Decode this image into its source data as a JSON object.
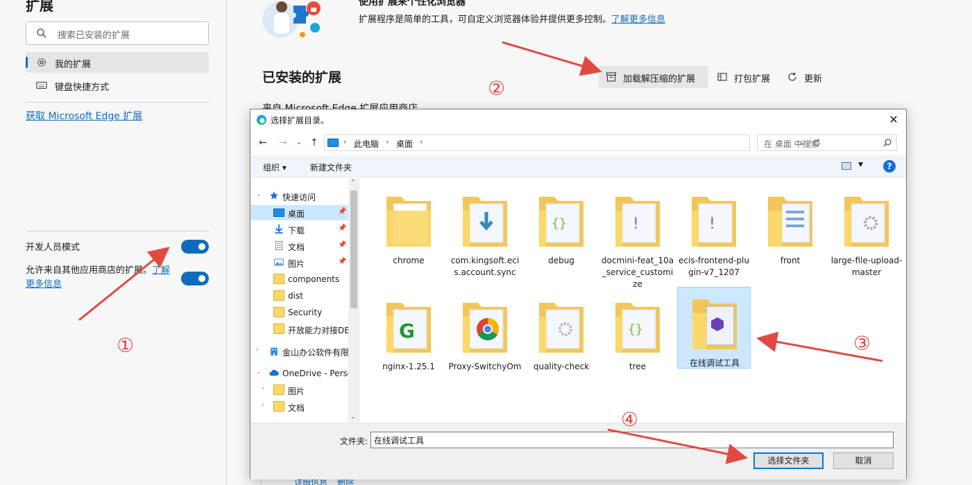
{
  "sidebar": {
    "title": "扩展",
    "search_placeholder": "搜索已安装的扩展",
    "items": [
      {
        "label": "我的扩展",
        "icon": "gear-icon"
      },
      {
        "label": "键盘快捷方式",
        "icon": "keyboard-icon"
      }
    ],
    "get_link": "获取 Microsoft Edge 扩展",
    "dev_mode_label": "开发人员模式",
    "allow_text": "允许来自其他应用商店的扩展。",
    "allow_link": "了解更多信息"
  },
  "hero": {
    "title": "使用扩展来个性化浏览器",
    "desc": "扩展程序是简单的工具，可自定义浏览器体验并提供更多控制。",
    "link": "了解更多信息"
  },
  "main": {
    "installed_title": "已安装的扩展",
    "toolbar": [
      {
        "label": "加载解压缩的扩展",
        "icon": "archive-icon"
      },
      {
        "label": "打包扩展",
        "icon": "package-icon"
      },
      {
        "label": "更新",
        "icon": "refresh-icon"
      }
    ],
    "from_store": "来自 Microsoft Edge 扩展应用商店",
    "bottom_links": [
      "详细信息",
      "删除"
    ]
  },
  "dialog": {
    "title": "选择扩展目录。",
    "breadcrumb": [
      "此电脑",
      "桌面"
    ],
    "search_placeholder": "在 桌面 中搜索",
    "organize": "组织 ▾",
    "new_folder": "新建文件夹",
    "tree": [
      {
        "label": "快速访问",
        "icon": "star-icon"
      },
      {
        "label": "桌面",
        "icon": "desktop-icon",
        "selected": true
      },
      {
        "label": "下载",
        "icon": "download-icon"
      },
      {
        "label": "文档",
        "icon": "document-icon"
      },
      {
        "label": "图片",
        "icon": "picture-icon"
      },
      {
        "label": "components",
        "icon": "folder-icon"
      },
      {
        "label": "dist",
        "icon": "folder-icon"
      },
      {
        "label": "Security",
        "icon": "folder-icon"
      },
      {
        "label": "开放能力对接DE",
        "icon": "folder-icon"
      },
      {
        "label": "金山办公软件有限",
        "icon": "building-icon"
      },
      {
        "label": "OneDrive - Perso",
        "icon": "cloud-icon"
      },
      {
        "label": "图片",
        "icon": "folder-icon"
      },
      {
        "label": "文档",
        "icon": "folder-icon"
      }
    ],
    "files": [
      {
        "name": "chrome",
        "icon": "folder-icon"
      },
      {
        "name": "com.kingsoft.ecis.account.sync",
        "icon": "folder-vscode-icon"
      },
      {
        "name": "debug",
        "icon": "folder-json-icon"
      },
      {
        "name": "docmini-feat_10a_service_customize",
        "icon": "folder-warning-icon"
      },
      {
        "name": "ecis-frontend-plugin-v7_1207",
        "icon": "folder-warning-icon"
      },
      {
        "name": "front",
        "icon": "folder-docs-icon"
      },
      {
        "name": "large-file-upload-master",
        "icon": "folder-gear-icon"
      },
      {
        "name": "nginx-1.25.1",
        "icon": "folder-nginx-icon"
      },
      {
        "name": "Proxy-SwitchyOm",
        "icon": "folder-chrome-icon"
      },
      {
        "name": "quality-check",
        "icon": "folder-gear-icon"
      },
      {
        "name": "tree",
        "icon": "folder-json-icon"
      },
      {
        "name": "在线调试工具",
        "icon": "folder-app-icon",
        "selected": true
      }
    ],
    "folder_label": "文件夹:",
    "folder_value": "在线调试工具",
    "select_button": "选择文件夹",
    "cancel_button": "取消"
  },
  "annotations": [
    "①",
    "②",
    "③",
    "④"
  ],
  "colors": {
    "accent": "#0f6cbd",
    "arrow": "#e04a43",
    "selection": "#cce8ff",
    "folder": "#fbd86a"
  }
}
